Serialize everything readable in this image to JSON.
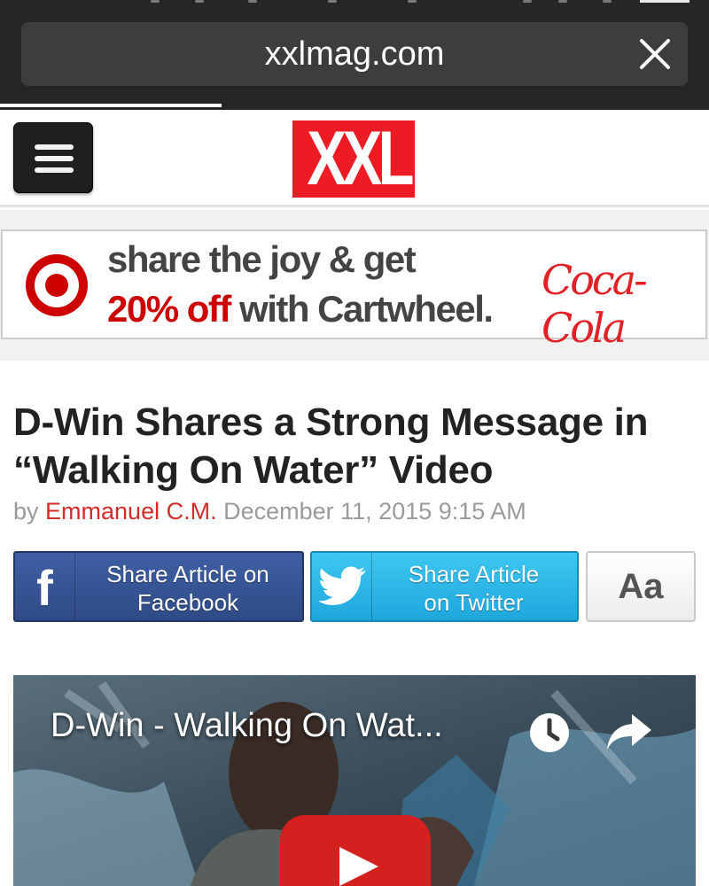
{
  "browser": {
    "url": "xxlmag.com"
  },
  "site": {
    "logo_text": "XXL"
  },
  "ad": {
    "line1": "share the joy & get",
    "line2_highlight": "20% off",
    "line2_rest": " with Cartwheel.",
    "brand": "Coca-Cola",
    "colors": {
      "target_red": "#cc0000",
      "coke_red": "#e32026"
    }
  },
  "article": {
    "title": "D-Win Shares a Strong Message in “Walking On Water” Video",
    "by": "by ",
    "author": "Emmanuel C.M.",
    "date": " December 11, 2015 9:15 AM"
  },
  "share": {
    "facebook_label_line1": "Share Article on",
    "facebook_label_line2": "Facebook",
    "twitter_label_line1": "Share Article",
    "twitter_label_line2": "on Twitter",
    "text_size_label": "Aa",
    "colors": {
      "facebook": "#3b5998",
      "twitter": "#2bb5e8"
    }
  },
  "video": {
    "title": "D-Win - Walking On Wat...",
    "icons": [
      "clock-icon",
      "share-arrow-icon",
      "play-icon"
    ]
  }
}
